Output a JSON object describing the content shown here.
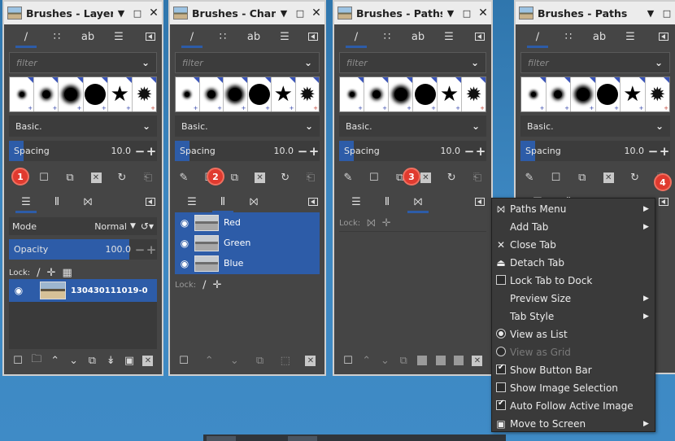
{
  "docks": [
    {
      "title": "Brushes - Layers"
    },
    {
      "title": "Brushes - Channe"
    },
    {
      "title": "Brushes - Paths"
    },
    {
      "title": "Brushes - Paths"
    }
  ],
  "common": {
    "filter_placeholder": "filter",
    "tag_preset": "Basic.",
    "spacing_label": "Spacing",
    "spacing_value": "10.0",
    "lock_label": "Lock:",
    "brush_tags": [
      "+",
      "+",
      "+",
      "+",
      "+",
      "+"
    ],
    "win_buttons": [
      "▼",
      "□",
      "✕"
    ]
  },
  "layers": {
    "mode_label": "Mode",
    "mode_value": "Normal",
    "opacity_label": "Opacity",
    "opacity_value": "100.0",
    "opacity_fraction": 1.0,
    "layer_name": "130430111019-0"
  },
  "channels": {
    "items": [
      "Red",
      "Green",
      "Blue"
    ]
  },
  "badges": [
    "1",
    "2",
    "3",
    "4"
  ],
  "context_menu": [
    {
      "label": "Paths Menu",
      "kind": "icon",
      "icon": "paths-icon",
      "submenu": true
    },
    {
      "label": "Add Tab",
      "kind": "none",
      "submenu": true
    },
    {
      "label": "Close Tab",
      "kind": "icon",
      "icon": "close-icon",
      "submenu": false
    },
    {
      "label": "Detach Tab",
      "kind": "icon",
      "icon": "detach-icon",
      "submenu": false
    },
    {
      "label": "Lock Tab to Dock",
      "kind": "check",
      "checked": false,
      "submenu": false
    },
    {
      "label": "Preview Size",
      "kind": "none",
      "submenu": true
    },
    {
      "label": "Tab Style",
      "kind": "none",
      "submenu": true
    },
    {
      "label": "View as List",
      "kind": "radio",
      "checked": true,
      "submenu": false
    },
    {
      "label": "View as Grid",
      "kind": "radio",
      "checked": false,
      "disabled": true,
      "submenu": false
    },
    {
      "label": "Show Button Bar",
      "kind": "check",
      "checked": true,
      "submenu": false
    },
    {
      "label": "Show Image Selection",
      "kind": "check",
      "checked": false,
      "submenu": false
    },
    {
      "label": "Auto Follow Active Image",
      "kind": "check",
      "checked": true,
      "submenu": false
    },
    {
      "label": "Move to Screen",
      "kind": "icon",
      "icon": "screen-icon",
      "submenu": true
    }
  ],
  "colors": {
    "accent": "#2d5ca8",
    "badge": "#e03a2f",
    "panel": "#454545"
  }
}
